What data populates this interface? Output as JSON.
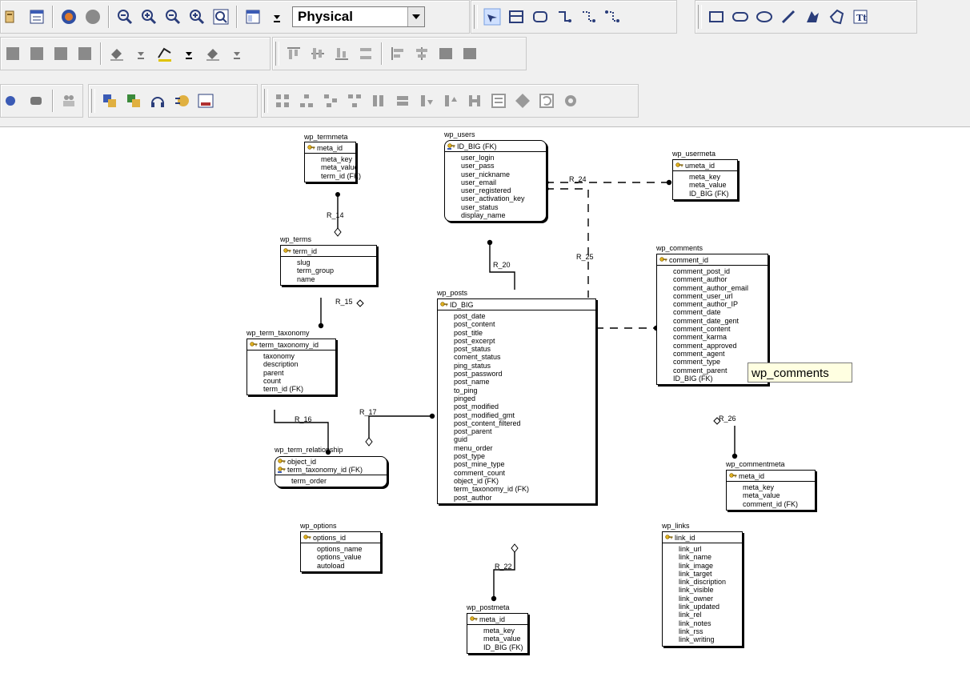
{
  "toolbar": {
    "model_view_selected": "Physical",
    "model_view_options": [
      "Physical"
    ]
  },
  "tables": [
    {
      "id": "wp_termmeta",
      "name": "wp_termmeta",
      "pk": "meta_id",
      "cols": [
        "meta_key",
        "meta_value",
        "term_id (FK)"
      ]
    },
    {
      "id": "wp_users",
      "name": "wp_users",
      "pk": "ID_BIG (FK)",
      "cols": [
        "user_login",
        "user_pass",
        "user_nickname",
        "user_email",
        "user_registered",
        "user_activation_key",
        "user_status",
        "display_name"
      ]
    },
    {
      "id": "wp_usermeta",
      "name": "wp_usermeta",
      "pk": "umeta_id",
      "cols": [
        "meta_key",
        "meta_value",
        "ID_BIG (FK)"
      ]
    },
    {
      "id": "wp_terms",
      "name": "wp_terms",
      "pk": "term_id",
      "cols": [
        "slug",
        "term_group",
        "name"
      ]
    },
    {
      "id": "wp_comments",
      "name": "wp_comments",
      "pk": "comment_id",
      "cols": [
        "comment_post_id",
        "comment_author",
        "comment_author_email",
        "comment_user_url",
        "comment_author_IP",
        "comment_date",
        "comment_date_gent",
        "comment_content",
        "comment_karma",
        "comment_approved",
        "comment_agent",
        "comment_type",
        "comment_parent",
        "ID_BIG (FK)"
      ]
    },
    {
      "id": "wp_posts",
      "name": "wp_posts",
      "pk": "ID_BIG",
      "cols": [
        "post_date",
        "post_content",
        "post_title",
        "post_excerpt",
        "post_status",
        "coment_status",
        "ping_status",
        "post_password",
        "post_name",
        "to_ping",
        "pinged",
        "post_modified",
        "post_modified_gmt",
        "post_content_filtered",
        "post_parent",
        "guid",
        "menu_order",
        "post_type",
        "post_mine_type",
        "comment_count",
        "object_id (FK)",
        "term_taxonomy_id (FK)",
        "post_author"
      ]
    },
    {
      "id": "wp_term_taxonomy",
      "name": "wp_term_taxonomy",
      "pk": "term_taxonomy_id",
      "cols": [
        "taxonomy",
        "description",
        "parent",
        "count",
        "term_id (FK)"
      ]
    },
    {
      "id": "wp_term_relationship",
      "name": "wp_term_relationship",
      "pk": "object_id",
      "pk2": "term_taxonomy_id (FK)",
      "cols": [
        "term_order"
      ]
    },
    {
      "id": "wp_commentmeta",
      "name": "wp_commentmeta",
      "pk": "meta_id",
      "cols": [
        "meta_key",
        "meta_value",
        "comment_id (FK)"
      ]
    },
    {
      "id": "wp_options",
      "name": "wp_options",
      "pk": "options_id",
      "cols": [
        "options_name",
        "options_value",
        "autoload"
      ]
    },
    {
      "id": "wp_links",
      "name": "wp_links",
      "pk": "link_id",
      "cols": [
        "link_url",
        "link_name",
        "link_image",
        "link_target",
        "link_discription",
        "link_visible",
        "link_owner",
        "link_updated",
        "link_rel",
        "link_notes",
        "link_rss",
        "link_writing"
      ]
    },
    {
      "id": "wp_postmeta",
      "name": "wp_postmeta",
      "pk": "meta_id",
      "cols": [
        "meta_key",
        "meta_value",
        "ID_BIG (FK)"
      ]
    }
  ],
  "relationships": {
    "r14": "R_14",
    "r24": "R_24",
    "r20": "R_20",
    "r25": "R_25",
    "r15": "R_15",
    "r16": "R_16",
    "r17": "R_17",
    "r26": "R_26",
    "r22": "R_22"
  },
  "tooltip": "wp_comments"
}
